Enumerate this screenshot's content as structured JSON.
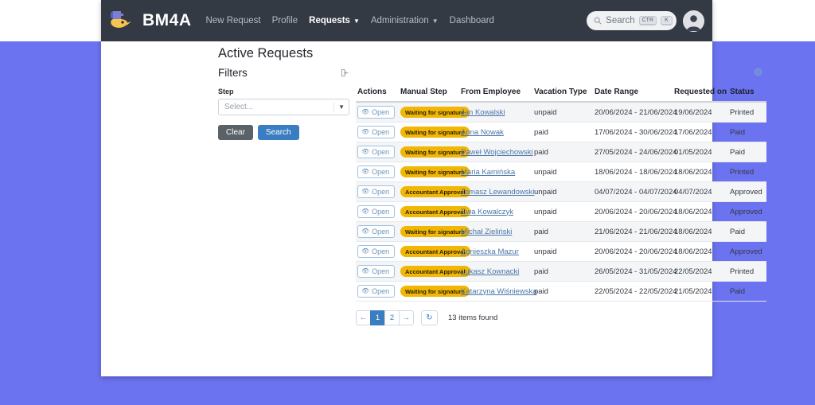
{
  "navbar": {
    "brand": "BM4A",
    "logo_icon": "bird-mascot-logo",
    "links": [
      {
        "label": "New Request",
        "active": false,
        "dropdown": false
      },
      {
        "label": "Profile",
        "active": false,
        "dropdown": false
      },
      {
        "label": "Requests",
        "active": true,
        "dropdown": true
      },
      {
        "label": "Administration",
        "active": false,
        "dropdown": true
      },
      {
        "label": "Dashboard",
        "active": false,
        "dropdown": false
      }
    ],
    "search": {
      "placeholder": "Search",
      "icon": "search-icon",
      "kbd_1": "CTR",
      "kbd_2": "K"
    },
    "avatar_icon": "user-avatar-icon"
  },
  "page": {
    "title": "Active Requests"
  },
  "filters": {
    "title": "Filters",
    "collapse_icon": "collapse-panel-icon",
    "step_label": "Step",
    "step_value": "Select...",
    "chevron_icon": "chevron-down-icon",
    "clear_label": "Clear",
    "search_label": "Search"
  },
  "table": {
    "settings_icon": "gear-icon",
    "columns": [
      "Actions",
      "Manual Step",
      "From Employee",
      "Vacation Type",
      "Date Range",
      "Requested on",
      "Status"
    ],
    "open_label": "Open",
    "open_icon": "eye-icon",
    "rows": [
      {
        "step": "Waiting for signature",
        "employee": "Jan Kowalski",
        "type": "unpaid",
        "range": "20/06/2024 - 21/06/2024",
        "requested": "19/06/2024",
        "status": "Printed"
      },
      {
        "step": "Waiting for signature",
        "employee": "Anna Nowak",
        "type": "paid",
        "range": "17/06/2024 - 30/06/2024",
        "requested": "17/06/2024",
        "status": "Paid"
      },
      {
        "step": "Waiting for signature",
        "employee": "Paweł Wojciechowski",
        "type": "paid",
        "range": "27/05/2024 - 24/06/2024",
        "requested": "01/05/2024",
        "status": "Paid"
      },
      {
        "step": "Waiting for signature",
        "employee": "Maria Kamińska",
        "type": "unpaid",
        "range": "18/06/2024 - 18/06/2024",
        "requested": "18/06/2024",
        "status": "Printed"
      },
      {
        "step": "Accountant Approval",
        "employee": "Tomasz Lewandowski",
        "type": "unpaid",
        "range": "04/07/2024 - 04/07/2024",
        "requested": "04/07/2024",
        "status": "Approved"
      },
      {
        "step": "Accountant Approval",
        "employee": "Ewa Kowalczyk",
        "type": "unpaid",
        "range": "20/06/2024 - 20/06/2024",
        "requested": "18/06/2024",
        "status": "Approved"
      },
      {
        "step": "Waiting for signature",
        "employee": "Michał Zieliński",
        "type": "paid",
        "range": "21/06/2024 - 21/06/2024",
        "requested": "18/06/2024",
        "status": "Paid"
      },
      {
        "step": "Accountant Approval",
        "employee": "Agnieszka Mazur",
        "type": "unpaid",
        "range": "20/06/2024 - 20/06/2024",
        "requested": "18/06/2024",
        "status": "Approved"
      },
      {
        "step": "Accountant Approval",
        "employee": "Łukasz Kownacki",
        "type": "paid",
        "range": "26/05/2024 - 31/05/2024",
        "requested": "22/05/2024",
        "status": "Printed"
      },
      {
        "step": "Waiting for signature",
        "employee": "Katarzyna Wiśniewska",
        "type": "paid",
        "range": "22/05/2024 - 22/05/2024",
        "requested": "21/05/2024",
        "status": "Paid"
      }
    ]
  },
  "pagination": {
    "prev_icon": "arrow-left-icon",
    "next_icon": "arrow-right-icon",
    "pages": [
      "1",
      "2"
    ],
    "active_page": "1",
    "refresh_icon": "refresh-icon",
    "items_found": "13 items found"
  },
  "colors": {
    "navbar_bg": "#343a44",
    "desktop_bg": "#6c73f0",
    "badge_bg": "#f2b705",
    "link": "#4a76a8",
    "primary_button": "#3a7ec1"
  }
}
